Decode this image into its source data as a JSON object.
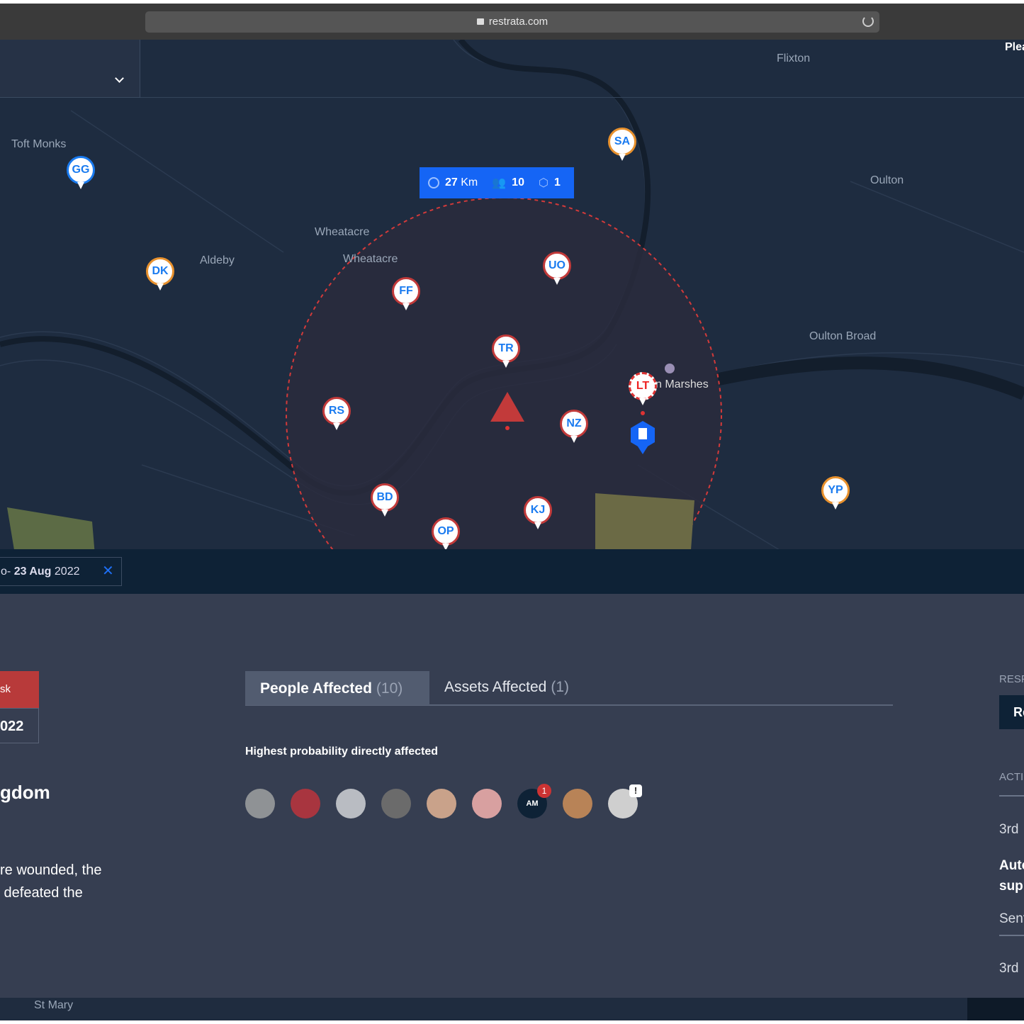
{
  "browser": {
    "url": "restrata.com"
  },
  "map": {
    "places": [
      "Flixton",
      "Plea",
      "Toft Monks",
      "Oulton",
      "Wheatacre",
      "Wheatacre",
      "Aldeby",
      "Oulton Broad",
      "n Marshes",
      "St Mary"
    ],
    "stats": {
      "radius_value": "27",
      "radius_unit": "Km",
      "people": "10",
      "assets": "1"
    },
    "pins": [
      {
        "label": "GG",
        "style": "blue"
      },
      {
        "label": "SA",
        "style": "orange"
      },
      {
        "label": "DK",
        "style": "orange"
      },
      {
        "label": "UO",
        "style": "red"
      },
      {
        "label": "FF",
        "style": "red"
      },
      {
        "label": "TR",
        "style": "red"
      },
      {
        "label": "RS",
        "style": "red"
      },
      {
        "label": "NZ",
        "style": "red"
      },
      {
        "label": "LT",
        "style": "dashed-red"
      },
      {
        "label": "BD",
        "style": "red"
      },
      {
        "label": "KJ",
        "style": "red"
      },
      {
        "label": "OP",
        "style": "red"
      },
      {
        "label": "YP",
        "style": "orange"
      }
    ],
    "colors": {
      "zone": "#d33a3a",
      "accent": "#1565f5",
      "incident": "#c23a3a"
    }
  },
  "datefilter": {
    "prefix": "o-",
    "day": "23 Aug",
    "year": "2022"
  },
  "incident": {
    "risk_label": "sk",
    "date": "022",
    "country": "gdom",
    "description": "re wounded, the\n defeated the"
  },
  "tabs": [
    {
      "label": "People Affected",
      "count": "(10)"
    },
    {
      "label": "Assets Affected",
      "count": "(1)"
    }
  ],
  "people": {
    "heading": "Highest probability directly affected",
    "avatars": [
      {
        "initials": "",
        "color": "#8f9295"
      },
      {
        "initials": "",
        "color": "#a8353f"
      },
      {
        "initials": "",
        "color": "#b9bcc2"
      },
      {
        "initials": "",
        "color": "#6b6b6b"
      },
      {
        "initials": "",
        "color": "#c9a28a"
      },
      {
        "initials": "",
        "color": "#d8a0a0"
      },
      {
        "initials": "AM",
        "color": "#0e2236",
        "badge": "1"
      },
      {
        "initials": "",
        "color": "#b88357"
      },
      {
        "initials": "",
        "color": "#cfcfcf",
        "warning": "!"
      }
    ]
  },
  "right": {
    "resp_label": "RESP",
    "resp_button": "Re",
    "actions_label": "ACTI",
    "item1_date": "3rd",
    "item1_title": "Auto\nsup",
    "item1_status": "Sent",
    "item2_date": "3rd"
  }
}
